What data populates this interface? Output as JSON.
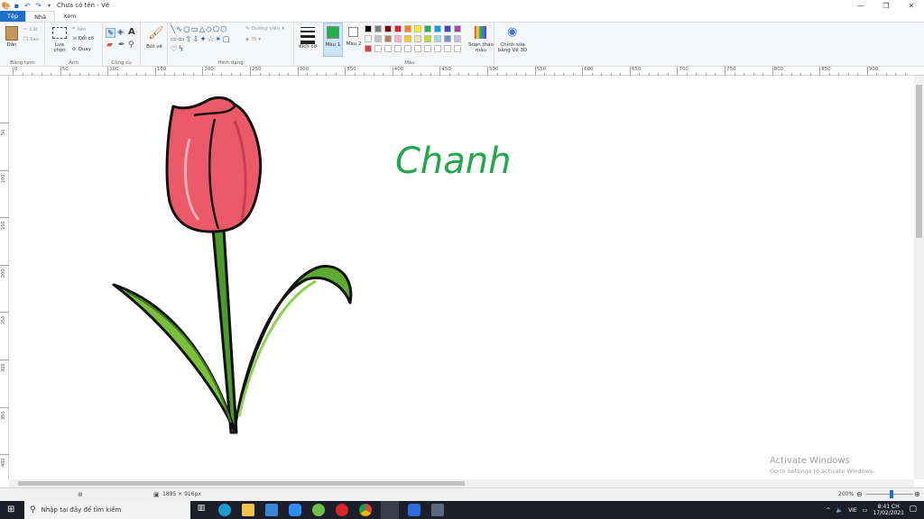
{
  "window": {
    "title": "Chưa có tên - Vẽ",
    "controls": [
      "—",
      "❐",
      "✕"
    ]
  },
  "tabs": [
    {
      "label": "Tệp"
    },
    {
      "label": "Nhà"
    },
    {
      "label": "Xem"
    }
  ],
  "ribbon": {
    "clipboard": {
      "label": "Bảng tạm",
      "paste": "Dán",
      "cut": "Cắt",
      "copy": "Sao"
    },
    "image": {
      "label": "Ảnh",
      "select": "Lựa chọn",
      "crop": "Xén",
      "resize": "Đổi cỡ",
      "rotate": "Quay"
    },
    "tools": {
      "label": "Công cụ"
    },
    "brushes": {
      "label": "Bút vẽ"
    },
    "shapes": {
      "label": "Hình dạng",
      "outline": "Đường viền",
      "fill": "Tô"
    },
    "size": {
      "label": "Kích cỡ"
    },
    "color1": {
      "label": "Màu 1",
      "value": "#22b14c"
    },
    "color2": {
      "label": "Màu 2",
      "value": "#ffffff"
    },
    "colors": {
      "label": "Màu"
    },
    "edit_colors": "Soạn thảo màu",
    "paint3d": "Chỉnh sửa bằng Vẽ 3D"
  },
  "palette": [
    "#000000",
    "#7f7f7f",
    "#880015",
    "#ed1c24",
    "#ff7f27",
    "#fff200",
    "#22b14c",
    "#00a2e8",
    "#3f48cc",
    "#a349a4",
    "#ffffff",
    "#c3c3c3",
    "#b97a57",
    "#ffaec9",
    "#ffc90e",
    "#efe4b0",
    "#b5e61d",
    "#99d9ea",
    "#7092be",
    "#c8bfe7",
    "#e03a44",
    "#ffffff",
    "#ffffff",
    "#ffffff",
    "#ffffff",
    "#ffffff",
    "#ffffff",
    "#ffffff",
    "#ffffff",
    "#ffffff"
  ],
  "ruler": {
    "h_labels": [
      "0",
      "50",
      "100",
      "150",
      "200",
      "250",
      "300",
      "350",
      "400",
      "450",
      "500",
      "550",
      "600",
      "650",
      "700",
      "750",
      "800",
      "850",
      "900"
    ],
    "v_labels": [
      "50",
      "100",
      "150",
      "200",
      "250",
      "300",
      "350",
      "400"
    ]
  },
  "canvas": {
    "text": "Chanh",
    "text_color": "#22a74a"
  },
  "status": {
    "dimensions": "1895 × 916px",
    "zoom": "200%"
  },
  "watermark": {
    "line1": "Activate Windows",
    "line2": "Go to Settings to activate Windows."
  },
  "taskbar": {
    "search_placeholder": "Nhập tại đây để tìm kiếm",
    "time": "8:41 CH",
    "date": "17/02/2021",
    "lang": "VIE"
  }
}
